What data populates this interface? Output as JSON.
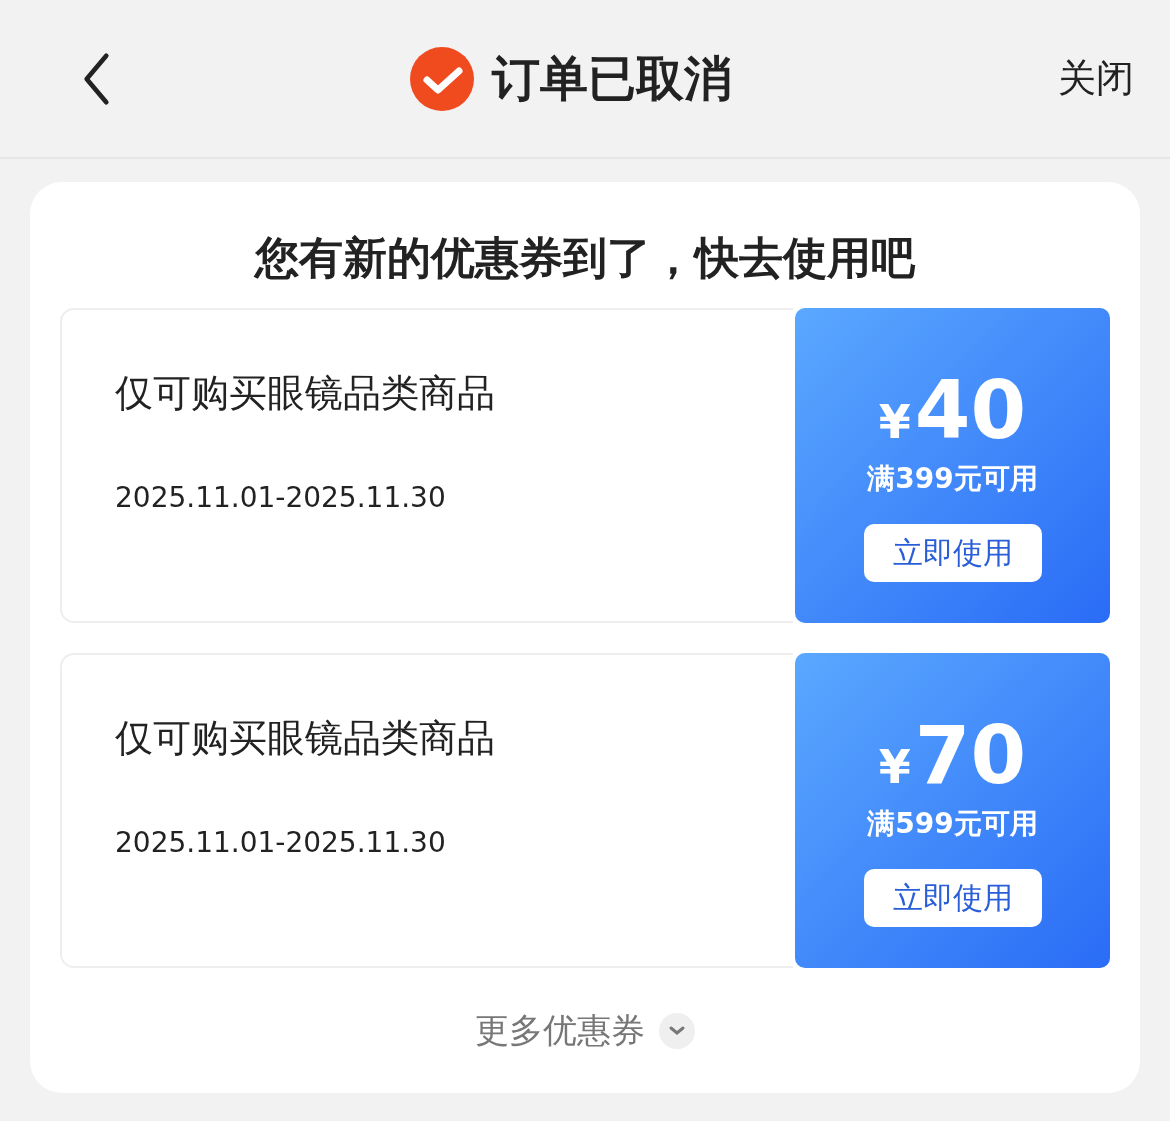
{
  "header": {
    "title": "订单已取消",
    "close": "关闭"
  },
  "panel": {
    "heading": "您有新的优惠券到了，快去使用吧",
    "coupons": [
      {
        "scope": "仅可购买眼镜品类商品",
        "period": "2025.11.01-2025.11.30",
        "currency": "¥",
        "amount": "40",
        "condition": "满399元可用",
        "button": "立即使用"
      },
      {
        "scope": "仅可购买眼镜品类商品",
        "period": "2025.11.01-2025.11.30",
        "currency": "¥",
        "amount": "70",
        "condition": "满599元可用",
        "button": "立即使用"
      }
    ],
    "more": "更多优惠券"
  }
}
